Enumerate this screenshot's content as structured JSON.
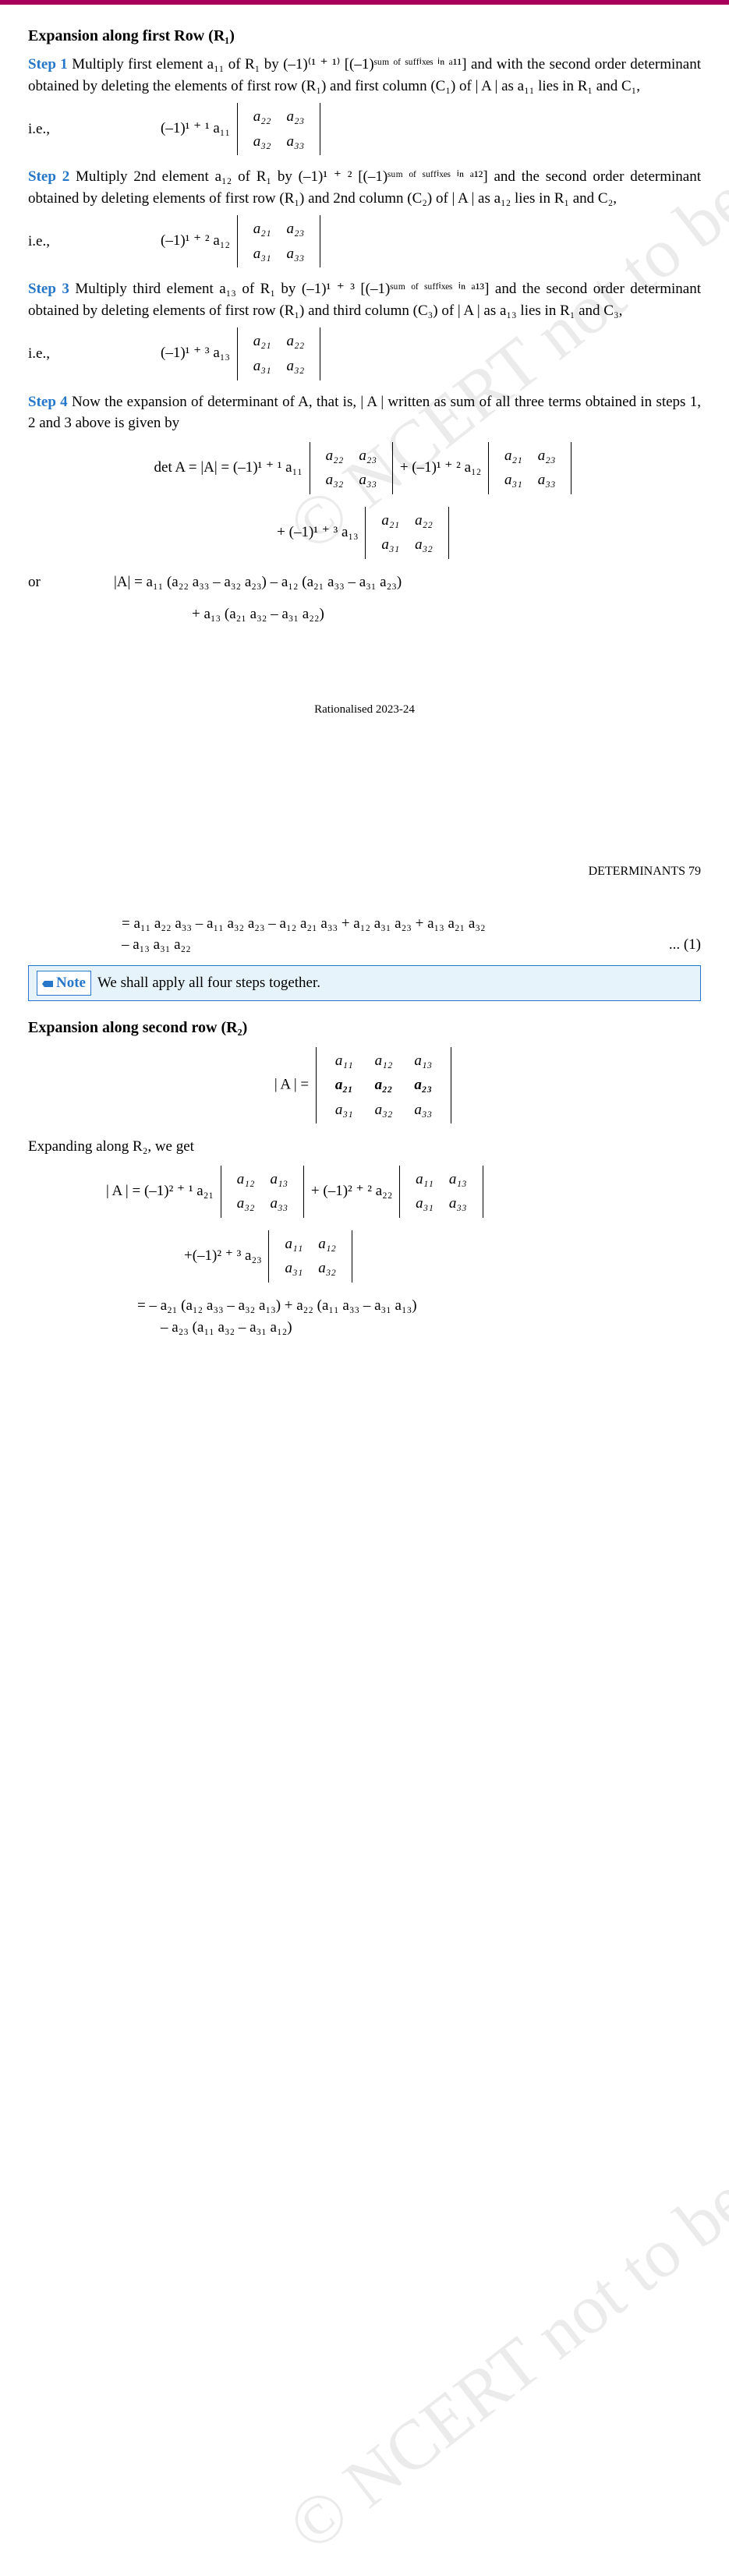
{
  "topbar_color": "#a8005b",
  "section1_title": "Expansion along first Row (R₁)",
  "step1_label": "Step 1",
  "step1_text": " Multiply first element a₁₁ of R₁ by (–1)⁽¹ ⁺ ¹⁾ [(–1)ˢᵘᵐ ᵒᶠ ˢᵘᶠᶠⁱˣᵉˢ ⁱⁿ ᵃ¹¹] and with the second order determinant obtained by deleting the elements of first row (R₁) and first column (C₁) of | A | as a₁₁ lies in R₁ and C₁,",
  "ie": "i.e.,",
  "s1_prefix": "(–1)¹ ⁺ ¹ a₁₁",
  "d1": {
    "r1c1": "a₂₂",
    "r1c2": "a₂₃",
    "r2c1": "a₃₂",
    "r2c2": "a₃₃"
  },
  "step2_label": "Step 2",
  "step2_text": " Multiply 2nd element a₁₂ of R₁ by (–1)¹ ⁺ ² [(–1)ˢᵘᵐ ᵒᶠ ˢᵘᶠᶠⁱˣᵉˢ ⁱⁿ ᵃ¹²] and the second order determinant obtained by deleting elements of first row (R₁) and 2nd column (C₂) of | A | as a₁₂ lies in R₁ and C₂,",
  "s2_prefix": "(–1)¹ ⁺ ² a₁₂",
  "d2": {
    "r1c1": "a₂₁",
    "r1c2": "a₂₃",
    "r2c1": "a₃₁",
    "r2c2": "a₃₃"
  },
  "step3_label": "Step 3",
  "step3_text": " Multiply third element a₁₃ of R₁ by (–1)¹ ⁺ ³ [(–1)ˢᵘᵐ ᵒᶠ ˢᵘᶠᶠⁱˣᵉˢ ⁱⁿ ᵃ¹³] and the second order determinant obtained by deleting elements of first row (R₁) and third column (C₃) of | A | as a₁₃ lies in R₁ and C₃,",
  "s3_prefix": "(–1)¹ ⁺ ³ a₁₃",
  "d3": {
    "r1c1": "a₂₁",
    "r1c2": "a₂₂",
    "r2c1": "a₃₁",
    "r2c2": "a₃₂"
  },
  "step4_label": "Step 4",
  "step4_text": " Now the expansion of determinant of A, that is, | A | written as sum of all three terms obtained in steps 1, 2 and 3 above is given by",
  "det_eq_lhs": "det A = |A| = (–1)¹ ⁺ ¹ a₁₁",
  "det_eq_mid": " + (–1)¹ ⁺ ² a₁₂",
  "det_eq_plus3": "+ (–1)¹ ⁺ ³ a₁₃",
  "or": "or",
  "expansion1": "|A| = a₁₁ (a₂₂ a₃₃ – a₃₂ a₂₃) – a₁₂ (a₂₁ a₃₃ – a₃₁ a₂₃)",
  "expansion1b": "+ a₁₃ (a₂₁ a₃₂ – a₃₁ a₂₂)",
  "footer": "Rationalised 2023-24",
  "page_header": "DETERMINANTS        79",
  "cont1": "= a₁₁ a₂₂ a₃₃ – a₁₁ a₃₂ a₂₃ – a₁₂ a₂₁ a₃₃ + a₁₂ a₃₁ a₂₃ + a₁₃ a₂₁ a₃₂",
  "cont2": "– a₁₃ a₃₁ a₂₂",
  "eqnum1": "... (1)",
  "note_label": "Note",
  "note_text": "We shall apply all four steps together.",
  "section2_title": "Expansion along second row (R₂)",
  "matA_lhs": "| A | =",
  "m3": {
    "r1c1": "a₁₁",
    "r1c2": "a₁₂",
    "r1c3": "a₁₃",
    "r2c1": "a₂₁",
    "r2c2": "a₂₂",
    "r2c3": "a₂₃",
    "r3c1": "a₃₁",
    "r3c2": "a₃₂",
    "r3c3": "a₃₃"
  },
  "expanding_text": "Expanding along R₂, we get",
  "r2_eq_lhs": "| A | = (–1)² ⁺ ¹ a₂₁",
  "dR2a": {
    "r1c1": "a₁₂",
    "r1c2": "a₁₃",
    "r2c1": "a₃₂",
    "r2c2": "a₃₃"
  },
  "r2_eq_mid": " + (–1)² ⁺ ² a₂₂",
  "dR2b": {
    "r1c1": "a₁₁",
    "r1c2": "a₁₃",
    "r2c1": "a₃₁",
    "r2c2": "a₃₃"
  },
  "r2_eq_plus3": "+(–1)² ⁺ ³ a₂₃",
  "dR2c": {
    "r1c1": "a₁₁",
    "r1c2": "a₁₂",
    "r2c1": "a₃₁",
    "r2c2": "a₃₂"
  },
  "r2_expansion1": "= – a₂₁ (a₁₂ a₃₃ – a₃₂ a₁₃) + a₂₂ (a₁₁ a₃₃ – a₃₁ a₁₃)",
  "r2_expansion2": "– a₂₃ (a₁₁ a₃₂ – a₃₁ a₁₂)",
  "watermark_text": "© NCERT not to be republished"
}
